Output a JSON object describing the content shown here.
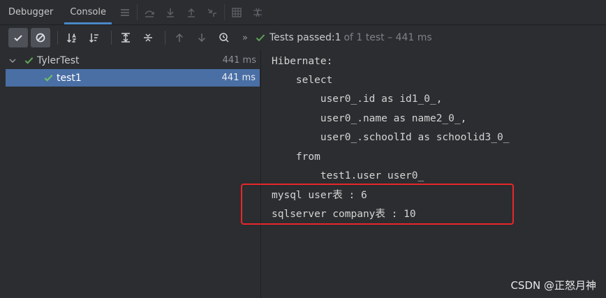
{
  "tabs": [
    {
      "label": "Debugger",
      "active": false
    },
    {
      "label": "Console",
      "active": true
    }
  ],
  "status": {
    "label": "Tests passed: ",
    "passed": "1",
    "rest": "of 1 test – 441 ms"
  },
  "tree": {
    "root": {
      "label": "TylerTest",
      "time": "441 ms"
    },
    "child": {
      "label": "test1",
      "time": "441 ms"
    }
  },
  "console_lines": [
    "Hibernate:",
    "    select",
    "        user0_.id as id1_0_,",
    "        user0_.name as name2_0_,",
    "        user0_.schoolId as schoolid3_0_",
    "    from",
    "        test1.user user0_",
    "mysql user表 : 6",
    "sqlserver company表 : 10"
  ],
  "watermark": "CSDN @正怒月神",
  "colors": {
    "accent": "#4a88c7",
    "selection": "#4a6fa5",
    "pass": "#5fa358",
    "highlight": "#e8262a"
  }
}
